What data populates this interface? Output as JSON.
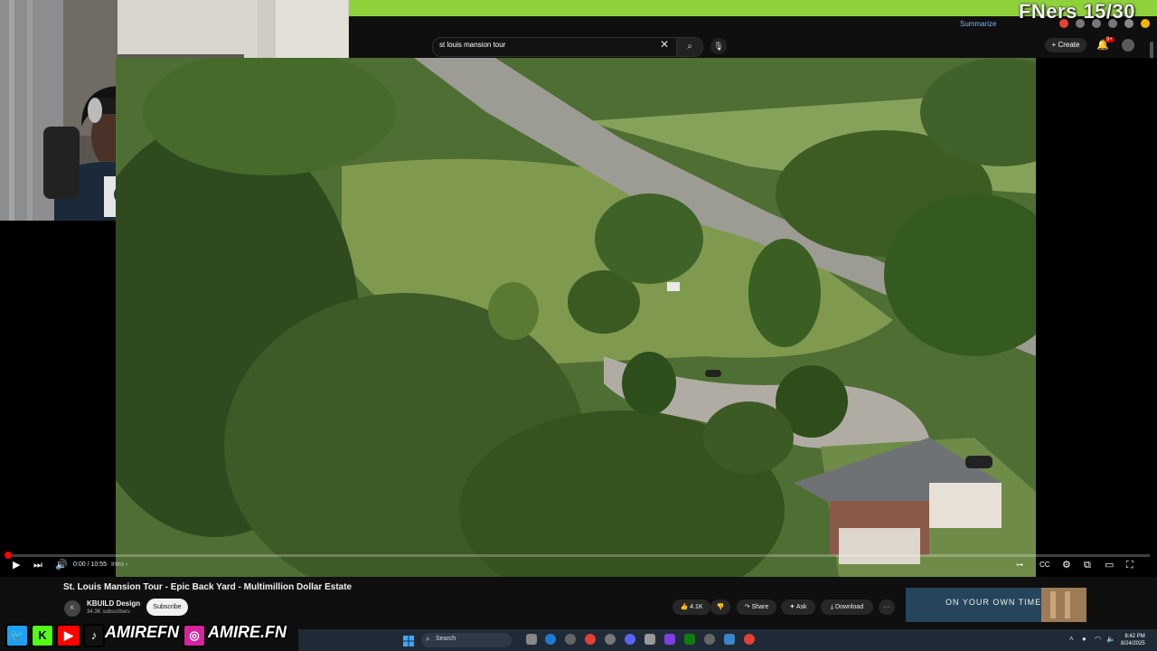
{
  "overlay": {
    "counter": "FNers 15/30"
  },
  "browser": {
    "summarize_label": "Summarize"
  },
  "youtube": {
    "search_value": "st louis mansion tour",
    "create_label": "Create",
    "notif_badge": "9+"
  },
  "player": {
    "time": "0:00 / 10:55",
    "chapter": "Intro ›",
    "icons": [
      "play-icon",
      "next-icon",
      "volume-icon",
      "captions-icon",
      "settings-icon",
      "miniplayer-icon",
      "theater-icon",
      "fullscreen-icon"
    ]
  },
  "video": {
    "title": "St. Louis Mansion Tour - Epic Back Yard - Multimillion Dollar Estate",
    "channel": "KBUILD Design",
    "subscribers": "34.3K subscribers",
    "subscribe_label": "Subscribe",
    "likes": "4.1K",
    "share_label": "Share",
    "ask_label": "Ask",
    "download_label": "Download",
    "more_label": "···"
  },
  "promo": {
    "text": "ON YOUR OWN TIME"
  },
  "social": {
    "handles": [
      "AMIREFN",
      "AMIRE.FN"
    ],
    "letters": [
      "K"
    ]
  },
  "taskbar": {
    "search_placeholder": "Search",
    "time": "8:42 PM",
    "date": "8/24/2025"
  },
  "colors": {
    "green_bar": "#8fd13a",
    "yt_red": "#ff0000",
    "taskbar": "#202a36"
  }
}
